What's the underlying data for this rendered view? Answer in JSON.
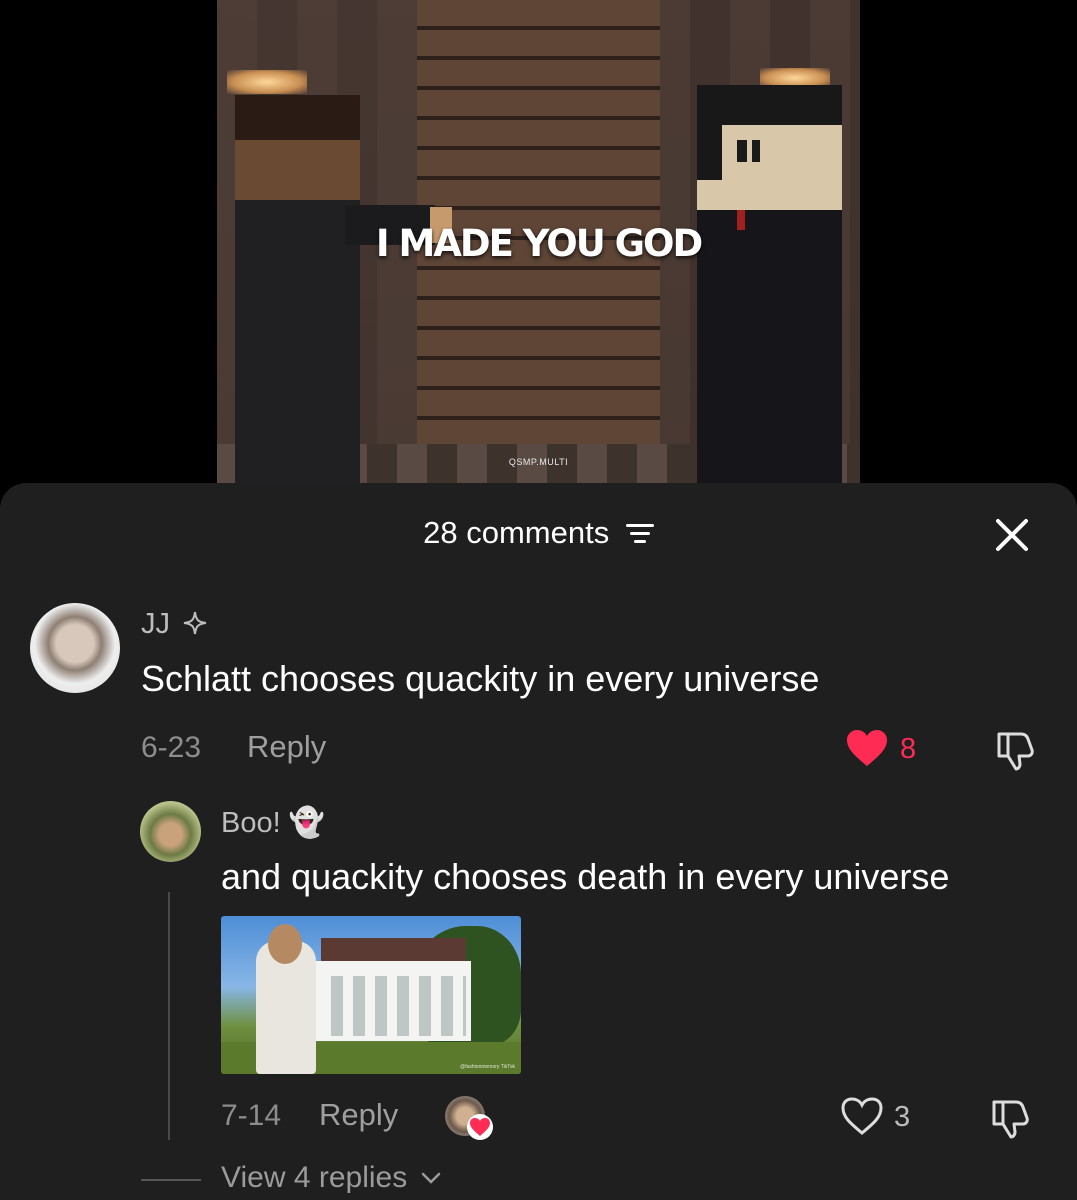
{
  "video": {
    "caption": "I MADE YOU GOD",
    "watermark": "QSMP.MULTI"
  },
  "panel": {
    "title": "28 comments",
    "filter_icon": "filter-icon",
    "close_icon": "close-icon"
  },
  "comments": [
    {
      "username": "JJ",
      "badge_icon": "sparkle-icon",
      "text": "Schlatt chooses quackity in every universe",
      "date": "6-23",
      "reply_label": "Reply",
      "likes": "8",
      "liked": true,
      "like_color": "#fe2c55"
    }
  ],
  "replies": [
    {
      "username": "Boo! 👻",
      "text": "and quackity chooses death in every universe",
      "image_watermark": "@fashionmemory",
      "image_brand": "TikTok",
      "date": "7-14",
      "reply_label": "Reply",
      "likes": "3",
      "liked": false,
      "creator_liked_icon": "creator-heart-icon"
    }
  ],
  "view_replies": "View 4 replies",
  "colors": {
    "panel_bg": "#1f1f1f",
    "accent": "#fe2c55"
  }
}
